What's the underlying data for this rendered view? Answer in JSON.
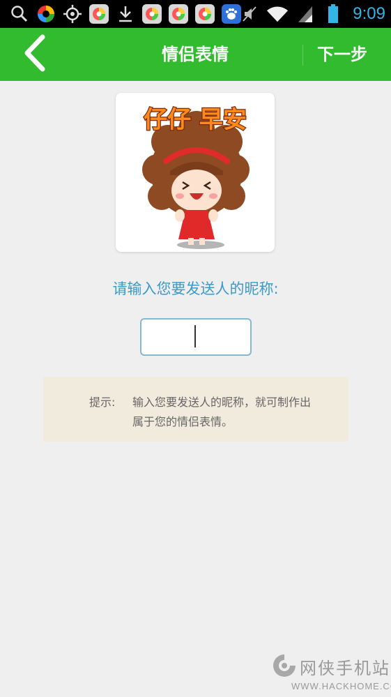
{
  "status_bar": {
    "time": "9:09",
    "left_icons": [
      "search-icon",
      "app-circle-icon",
      "gps-icon",
      "app-tile-icon",
      "download-icon",
      "app-tile-icon",
      "app-tile-icon",
      "app-tile-icon",
      "baidu-icon"
    ],
    "right_icons": [
      "mute-icon",
      "wifi-icon",
      "signal-icon",
      "battery-icon"
    ],
    "time_color": "#33b5e5"
  },
  "header": {
    "title": "情侣表情",
    "next_label": "下一步",
    "background": "#33bb2f"
  },
  "sticker": {
    "caption": "仔仔 早安"
  },
  "form": {
    "prompt": "请输入您要发送人的昵称:",
    "input_value": "",
    "input_placeholder": ""
  },
  "hint": {
    "label": "提示:",
    "text": "输入您要发送人的昵称，就可制作出属于您的情侣表情。"
  },
  "watermark": {
    "name": "网侠手机站",
    "url": "WWW.HACKHOME.COM"
  }
}
